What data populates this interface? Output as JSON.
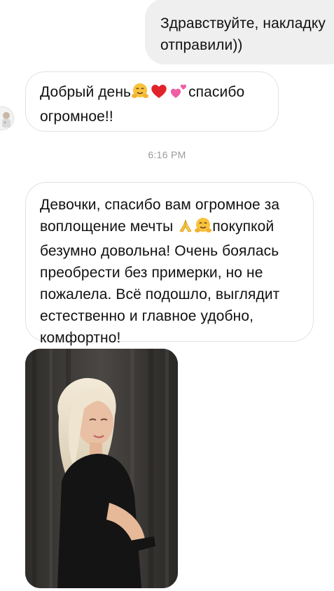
{
  "thread": {
    "outgoing_message": {
      "line1": "Здравствуйте, накладку",
      "line2": "отправили))"
    },
    "incoming_message_1": {
      "part1": "Добрый день",
      "part2": "спасибо",
      "line2": "огромное!!",
      "emojis": [
        "hugging-face",
        "red-heart",
        "two-hearts"
      ]
    },
    "timestamp": "6:16 PM",
    "incoming_message_2": {
      "line1": "Девочки, спасибо вам огромное за",
      "line2a": "воплощение мечты",
      "line2b": "покупкой",
      "line3": "безумно довольна! Очень боялась",
      "line4": "преобрести без примерки, но не",
      "line5": "пожалела. Всё подошло, выглядит",
      "line6": "естественно и главное удобно,",
      "line7": "комфортно!",
      "emojis": [
        "folded-hands",
        "hugging-face"
      ]
    },
    "photo": {
      "subject": "woman-with-blonde-hair-photo"
    }
  },
  "colors": {
    "outgoing_bubble": "#efefef",
    "incoming_border": "#e2e2e2",
    "timestamp_text": "#9a9a9a",
    "text": "#111111"
  }
}
